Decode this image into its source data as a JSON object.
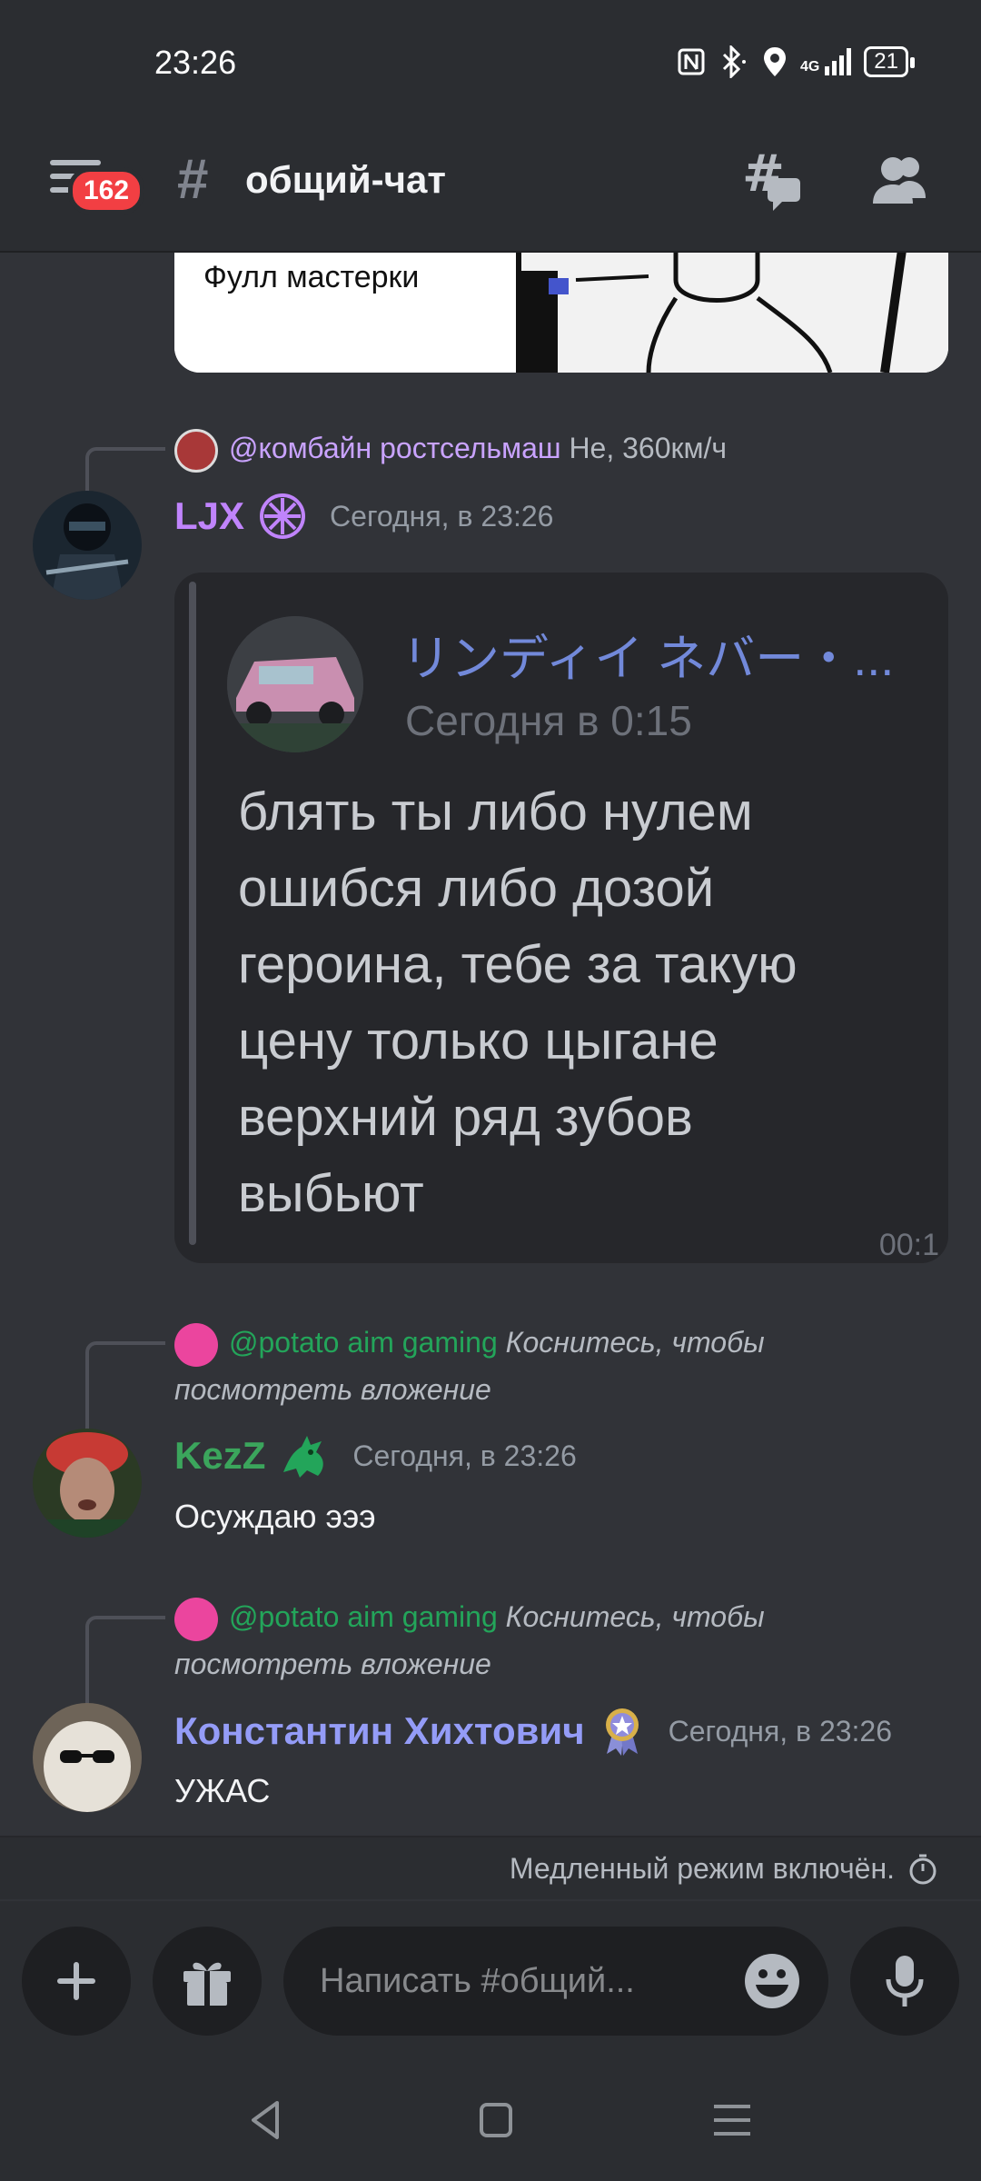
{
  "status_bar": {
    "time": "23:26",
    "network": "4G",
    "battery": "21"
  },
  "header": {
    "menu_badge": "162",
    "channel_name": "общий-чат"
  },
  "image_card": {
    "caption": "Фулл мастерки"
  },
  "messages": [
    {
      "reply": {
        "mention": "@комбайн ростсельмаш",
        "text": "Не, 360км/ч"
      },
      "username": "LJX",
      "username_color": "#c084fc",
      "timestamp": "Сегодня, в 23:26",
      "quote": {
        "author": "リンディイ ネバー・...",
        "time": "Сегодня в 0:15",
        "text": "блять ты либо нулем ошибся либо дозой героина, тебе за такую цену только цыгане верхний ряд зубов выбьют",
        "corner": "00:1"
      }
    },
    {
      "reply": {
        "mention": "@potato aim gaming",
        "text_line1": "Коснитесь, чтобы",
        "text_line2": "посмотреть вложение"
      },
      "username": "KezZ",
      "username_color": "#3ba55c",
      "timestamp": "Сегодня, в 23:26",
      "content": "Осуждаю эээ"
    },
    {
      "reply": {
        "mention": "@potato aim gaming",
        "text_line1": "Коснитесь, чтобы",
        "text_line2": "посмотреть вложение"
      },
      "username": "Константин Хихтович",
      "username_color": "#949cf7",
      "timestamp": "Сегодня, в 23:26",
      "content": "УЖАС"
    }
  ],
  "slow_mode": "Медленный режим включён.",
  "composer": {
    "placeholder": "Написать #общий..."
  },
  "colors": {
    "background": "#313338",
    "panel": "#2b2d31",
    "mention_violet": "#c9a3ff",
    "mention_green": "#23a55a",
    "badge": "#f23f43"
  },
  "icons": [
    "nfc-icon",
    "bluetooth-icon",
    "location-icon",
    "signal-icon",
    "battery-icon",
    "menu-icon",
    "hash-icon",
    "threads-icon",
    "members-icon",
    "plus-icon",
    "gift-icon",
    "emoji-icon",
    "mic-icon",
    "timer-icon",
    "back-icon",
    "home-icon",
    "recents-icon"
  ]
}
